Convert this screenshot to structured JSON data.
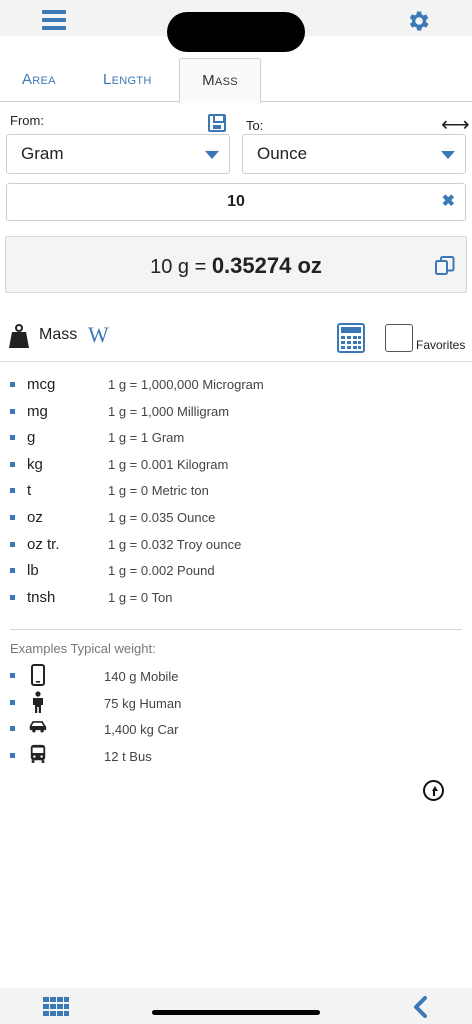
{
  "tabs": [
    {
      "label": "Area"
    },
    {
      "label": "Length"
    },
    {
      "label": "Mass"
    }
  ],
  "active_tab": "Mass",
  "converter": {
    "from_label": "From:",
    "to_label": "To:",
    "from_unit": "Gram",
    "to_unit": "Ounce",
    "input_value": "10",
    "result_prefix": "10 g = ",
    "result_value": "0.35274 oz"
  },
  "category": {
    "label": "Mass",
    "wiki_label": "W",
    "favorites_label": "Favorites",
    "favorites_checked": false
  },
  "units": [
    {
      "abbr": "mcg",
      "conv": "1 g = 1,000,000 Microgram"
    },
    {
      "abbr": "mg",
      "conv": "1 g = 1,000 Milligram"
    },
    {
      "abbr": "g",
      "conv": "1 g = 1 Gram"
    },
    {
      "abbr": "kg",
      "conv": "1 g = 0.001 Kilogram"
    },
    {
      "abbr": "t",
      "conv": "1 g = 0 Metric ton"
    },
    {
      "abbr": "oz",
      "conv": "1 g = 0.035 Ounce"
    },
    {
      "abbr": "oz tr.",
      "conv": "1 g = 0.032 Troy ounce"
    },
    {
      "abbr": "lb",
      "conv": "1 g = 0.002 Pound"
    },
    {
      "abbr": "tnsh",
      "conv": "1 g = 0 Ton"
    }
  ],
  "examples": {
    "title": "Examples Typical weight:",
    "items": [
      {
        "icon": "mobile-phone-icon",
        "text": "140 g Mobile"
      },
      {
        "icon": "human-icon",
        "text": "75 kg Human"
      },
      {
        "icon": "car-icon",
        "text": "1,400 kg Car"
      },
      {
        "icon": "bus-icon",
        "text": "12 t Bus"
      }
    ]
  },
  "colors": {
    "accent": "#3b78b8",
    "bar_background": "#f3f3f3"
  }
}
